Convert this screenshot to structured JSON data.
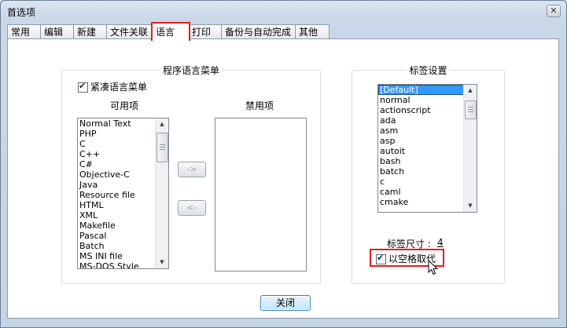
{
  "window": {
    "title": "首选项",
    "close_glyph": "✕"
  },
  "tabs": [
    {
      "label": "常用"
    },
    {
      "label": "编辑"
    },
    {
      "label": "新建"
    },
    {
      "label": "文件关联"
    },
    {
      "label": "语言",
      "active": true
    },
    {
      "label": "打印"
    },
    {
      "label": "备份与自动完成"
    },
    {
      "label": "其他"
    }
  ],
  "language_menu": {
    "group_title": "程序语言菜单",
    "compact_checkbox_label": "紧凑语言菜单",
    "compact_checked": true,
    "available_label": "可用项",
    "disabled_label": "禁用项",
    "available_items": [
      "Normal Text",
      "PHP",
      "C",
      "C++",
      "C#",
      "Objective-C",
      "Java",
      "Resource file",
      "HTML",
      "XML",
      "Makefile",
      "Pascal",
      "Batch",
      "MS INI file",
      "MS-DOS Style"
    ],
    "disabled_items": [],
    "move_right_label": "->",
    "move_left_label": "<-"
  },
  "tab_settings": {
    "group_title": "标签设置",
    "languages": [
      "[Default]",
      "normal",
      "actionscript",
      "ada",
      "asm",
      "asp",
      "autoit",
      "bash",
      "batch",
      "c",
      "caml",
      "cmake"
    ],
    "selected": "[Default]",
    "tab_size_label": "标签尺寸 :",
    "tab_size_value": "4",
    "replace_spaces_label": "以空格取代",
    "replace_spaces_checked": true
  },
  "footer": {
    "close_label": "关闭"
  },
  "colors": {
    "highlight": "#e81c1c",
    "selection": "#3399ff"
  }
}
